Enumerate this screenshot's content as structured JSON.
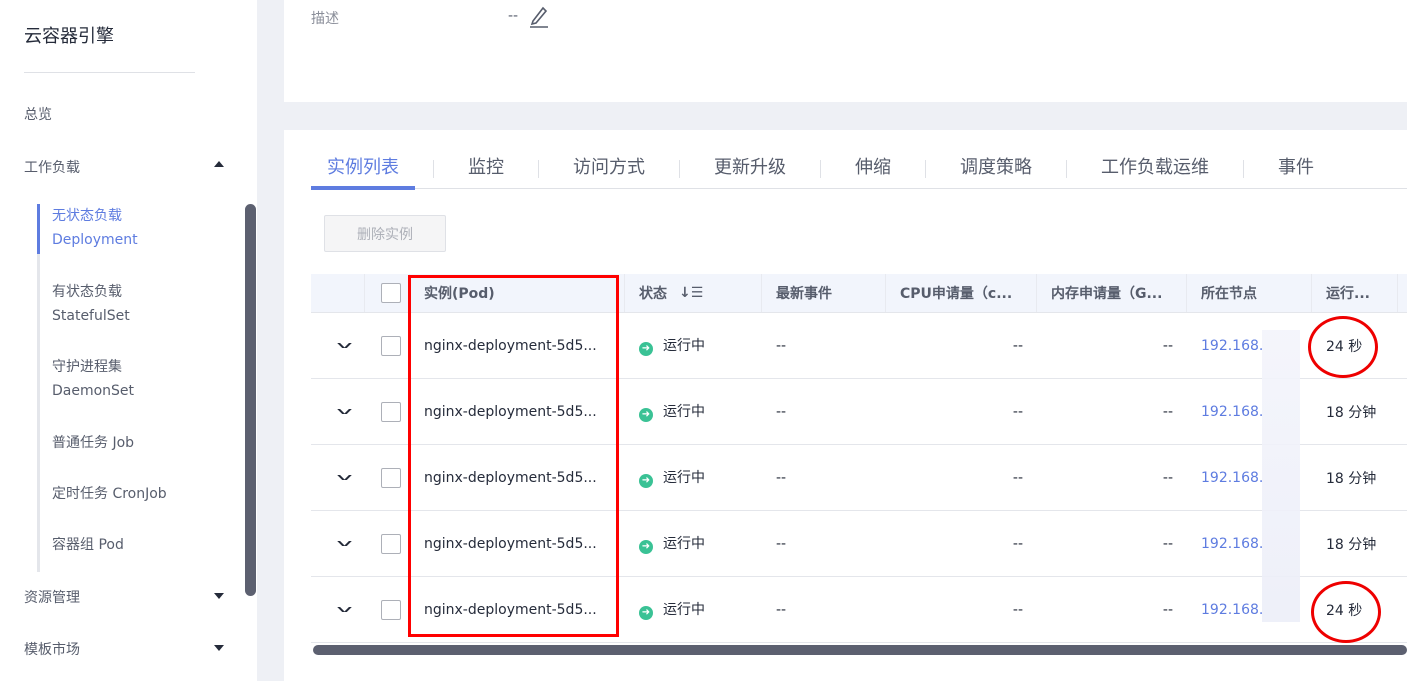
{
  "sidebar": {
    "brand": "云容器引擎",
    "overview": "总览",
    "workload": "工作负载",
    "sub": [
      [
        "无状态负载",
        "Deployment"
      ],
      [
        "有状态负载",
        "StatefulSet"
      ],
      [
        "守护进程集",
        "DaemonSet"
      ],
      [
        "普通任务 Job",
        ""
      ],
      [
        "定时任务 CronJob",
        ""
      ],
      [
        "容器组 Pod",
        ""
      ]
    ],
    "resource": "资源管理",
    "template": "模板市场"
  },
  "detail": {
    "desc_label": "描述",
    "desc_value": "--"
  },
  "tabs": [
    "实例列表",
    "监控",
    "访问方式",
    "更新升级",
    "伸缩",
    "调度策略",
    "工作负载运维",
    "事件"
  ],
  "delete_button": "删除实例",
  "table": {
    "headers": [
      "实例(Pod)",
      "状态",
      "最新事件",
      "CPU申请量（c...",
      "内存申请量（G...",
      "所在节点",
      "运行..."
    ],
    "rows": [
      {
        "pod": "nginx-deployment-5d5...",
        "status": "运行中",
        "event": "--",
        "cpu": "--",
        "mem": "--",
        "node": "192.168.",
        "age": "24 秒"
      },
      {
        "pod": "nginx-deployment-5d5...",
        "status": "运行中",
        "event": "--",
        "cpu": "--",
        "mem": "--",
        "node": "192.168.",
        "age": "18 分钟"
      },
      {
        "pod": "nginx-deployment-5d5...",
        "status": "运行中",
        "event": "--",
        "cpu": "--",
        "mem": "--",
        "node": "192.168.",
        "age": "18 分钟"
      },
      {
        "pod": "nginx-deployment-5d5...",
        "status": "运行中",
        "event": "--",
        "cpu": "--",
        "mem": "--",
        "node": "192.168.",
        "age": "18 分钟"
      },
      {
        "pod": "nginx-deployment-5d5...",
        "status": "运行中",
        "event": "--",
        "cpu": "--",
        "mem": "--",
        "node": "192.168.",
        "age": "24 秒"
      }
    ]
  },
  "colors": {
    "accent": "#5e7ce0",
    "running": "#3ac295",
    "highlight": "#ff0000"
  }
}
